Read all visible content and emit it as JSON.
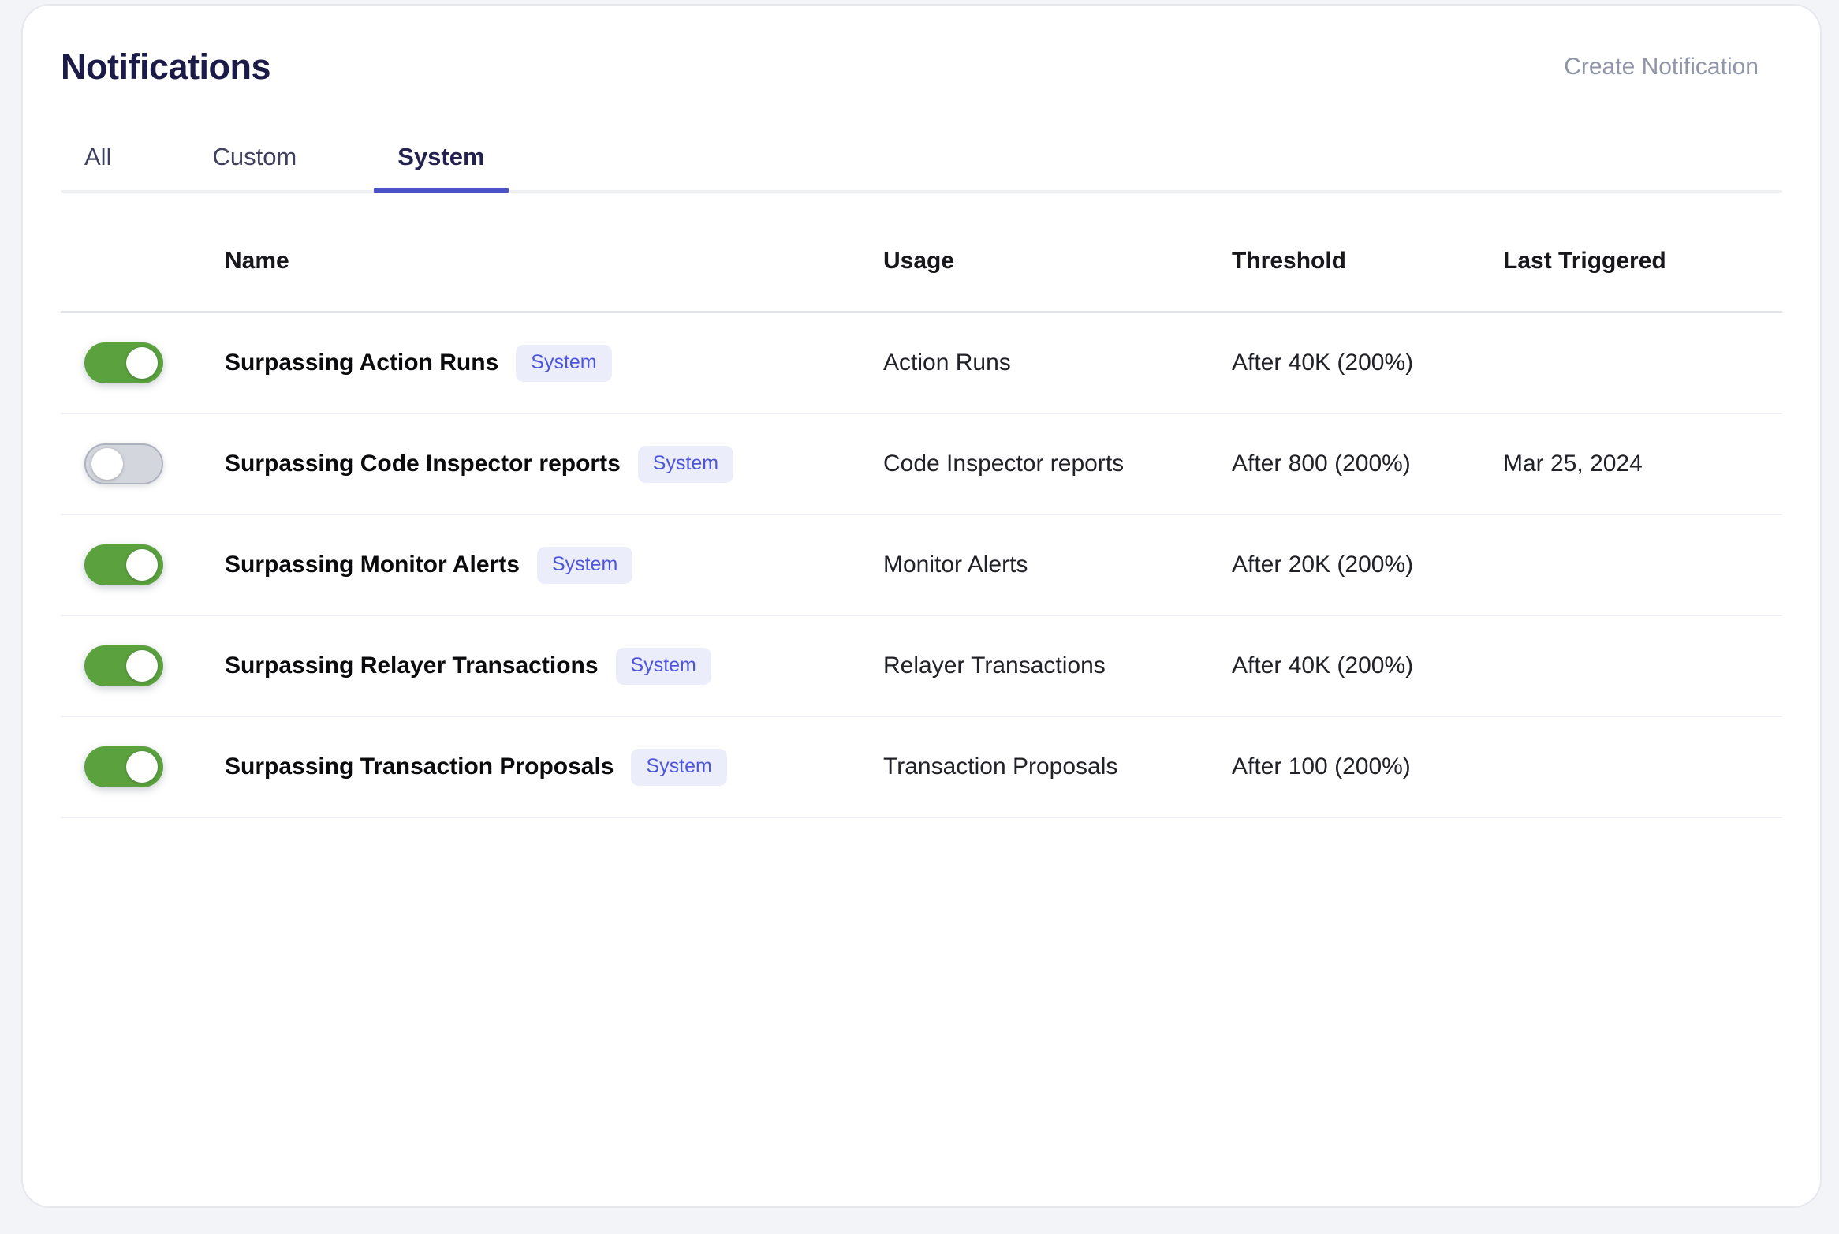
{
  "header": {
    "title": "Notifications",
    "create_label": "Create Notification"
  },
  "tabs": [
    {
      "label": "All",
      "active": false
    },
    {
      "label": "Custom",
      "active": false
    },
    {
      "label": "System",
      "active": true
    }
  ],
  "table": {
    "columns": {
      "name": "Name",
      "usage": "Usage",
      "threshold": "Threshold",
      "last_triggered": "Last Triggered"
    },
    "rows": [
      {
        "enabled": true,
        "name": "Surpassing Action Runs",
        "badge": "System",
        "usage": "Action Runs",
        "threshold": "After 40K (200%)",
        "last_triggered": ""
      },
      {
        "enabled": false,
        "name": "Surpassing Code Inspector reports",
        "badge": "System",
        "usage": "Code Inspector reports",
        "threshold": "After 800 (200%)",
        "last_triggered": "Mar 25, 2024"
      },
      {
        "enabled": true,
        "name": "Surpassing Monitor Alerts",
        "badge": "System",
        "usage": "Monitor Alerts",
        "threshold": "After 20K (200%)",
        "last_triggered": ""
      },
      {
        "enabled": true,
        "name": "Surpassing Relayer Transactions",
        "badge": "System",
        "usage": "Relayer Transactions",
        "threshold": "After 40K (200%)",
        "last_triggered": ""
      },
      {
        "enabled": true,
        "name": "Surpassing Transaction Proposals",
        "badge": "System",
        "usage": "Transaction Proposals",
        "threshold": "After 100 (200%)",
        "last_triggered": ""
      }
    ]
  },
  "colors": {
    "page-bg": "#f3f4f8",
    "card-border": "#e7e8ef",
    "title-color": "#1c1b47",
    "muted-color": "#8f94a7",
    "tab-color": "#3f3f5e",
    "tab-active-color": "#23224e",
    "accent": "#4b52c7",
    "line-soft": "#eef0f4",
    "line-strong": "#e2e3e9",
    "line-row": "#ececf1",
    "badge-bg": "#ebedfb",
    "badge-text": "#4f57d8",
    "toggle-on": "#5ba23e",
    "toggle-off": "#d4d6dd",
    "toggle-off-border": "#aeb1bf"
  }
}
